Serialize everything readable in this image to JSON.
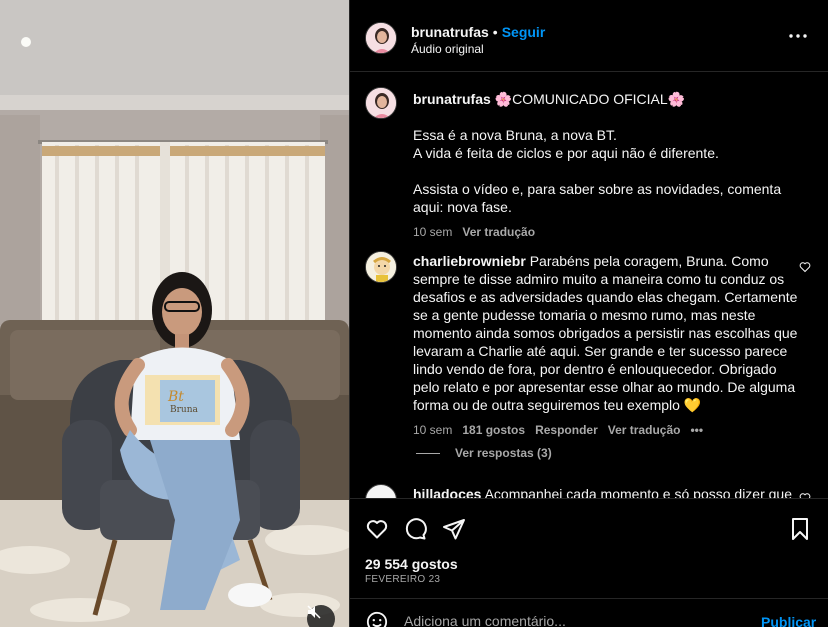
{
  "post": {
    "username": "brunatrufas",
    "separator": "•",
    "follow_label": "Seguir",
    "audio_label": "Áudio original"
  },
  "caption": {
    "username": "brunatrufas",
    "headline": "🌸COMUNICADO OFICIAL🌸",
    "line1": "Essa é a nova Bruna, a nova BT.",
    "line2": "A vida é feita de ciclos e por aqui não é diferente.",
    "line3": "Assista o vídeo e, para saber sobre as novidades, comenta aqui: nova fase.",
    "time": "10 sem",
    "translate": "Ver tradução"
  },
  "comments": [
    {
      "username": "charliebrowniebr",
      "text": "Parabéns pela coragem, Bruna. Como sempre te disse admiro muito a maneira como tu conduz os desafios e as adversidades quando elas chegam. Certamente se a gente pudesse tomaria o mesmo rumo, mas neste momento ainda somos obrigados a persistir nas escolhas que levaram a Charlie até aqui. Ser grande e ter sucesso parece lindo vendo de fora, por dentro é enlouquecedor. Obrigado pelo relato e por apresentar esse olhar ao mundo. De alguma forma ou de outra seguiremos teu exemplo 💛",
      "time": "10 sem",
      "likes": "181 gostos",
      "reply": "Responder",
      "translate": "Ver tradução",
      "more": "•••",
      "view_replies": "Ver respostas (3)"
    },
    {
      "username": "hilladoces",
      "text": "Acompanhei cada momento e só posso dizer que"
    }
  ],
  "actions": {
    "likes_count": "29 554 gostos",
    "date": "FEVEREIRO 23"
  },
  "composer": {
    "placeholder": "Adiciona um comentário...",
    "publish_label": "Publicar"
  },
  "media": {
    "sweater_logo": "Bt",
    "sweater_text": "Bruna"
  },
  "colors": {
    "accent": "#0095f6",
    "background": "#000000",
    "muted": "#a8a8a8",
    "divider": "#262626"
  },
  "icons": [
    "heart-icon",
    "comment-icon",
    "share-icon",
    "bookmark-icon",
    "emoji-icon",
    "more-icon",
    "mute-icon"
  ]
}
